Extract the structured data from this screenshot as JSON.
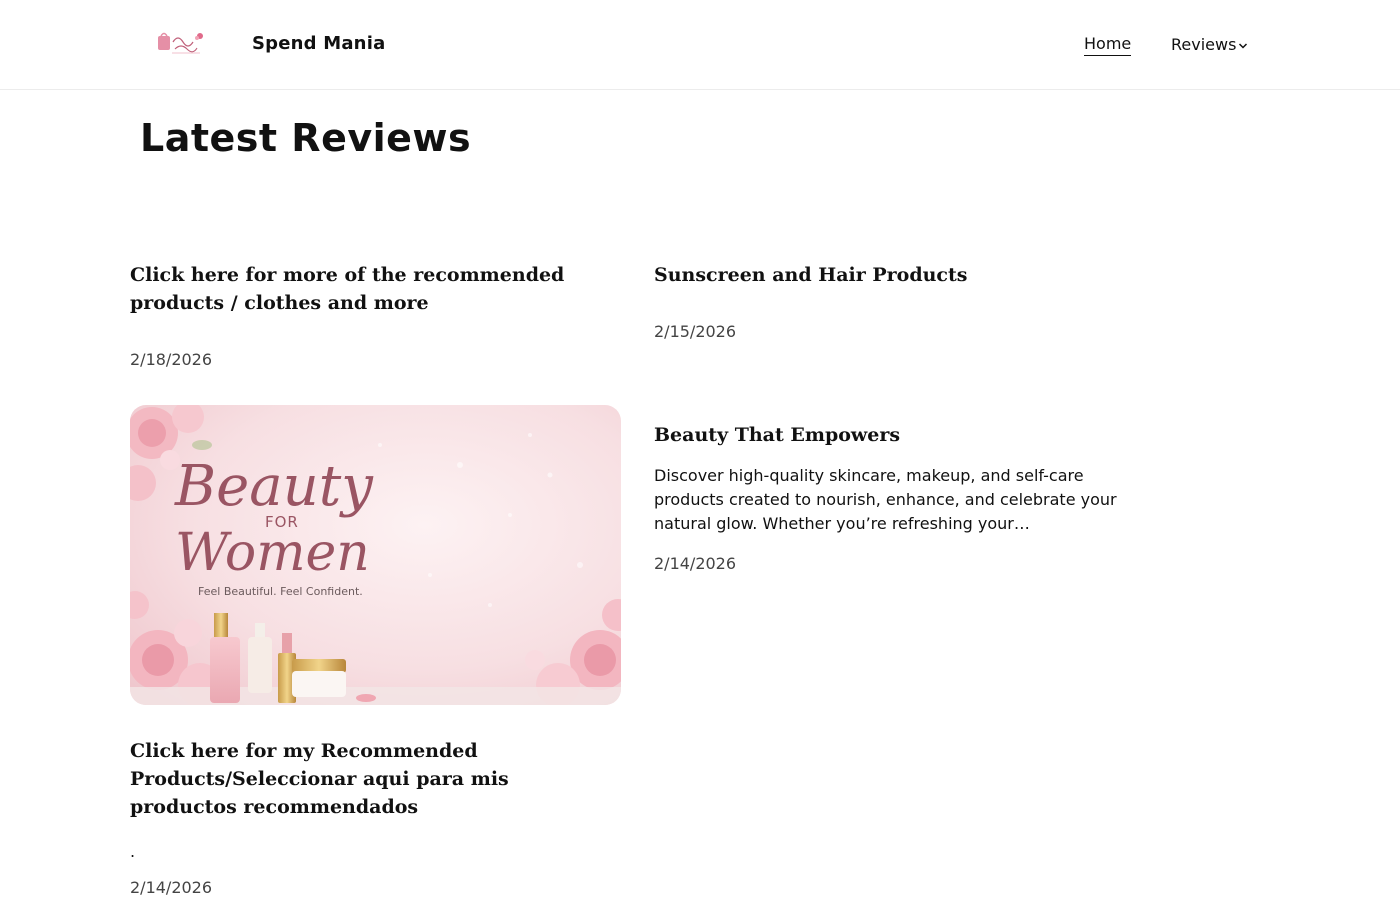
{
  "header": {
    "logo_alt": "Beauty & Fashion",
    "site_title": "Spend Mania",
    "nav": {
      "home_label": "Home",
      "reviews_label": "Reviews"
    }
  },
  "main": {
    "heading": "Latest Reviews",
    "posts": [
      {
        "title": "Click here for more of the recommended products / clothes and more",
        "date": "2/18/2026"
      },
      {
        "title": "Sunscreen and Hair Products",
        "date": "2/15/2026"
      },
      {
        "image": {
          "script_line1": "Beauty",
          "for_text": "FOR",
          "script_line2": "Women",
          "tagline": "Feel Beautiful. Feel Confident."
        },
        "title": "Click here for my Recommended Products/Seleccionar aqui para mis productos recommendados",
        "excerpt": ".",
        "date": "2/14/2026"
      },
      {
        "title": "Beauty That Empowers",
        "excerpt": "Discover high-quality skincare, makeup, and self-care products created to nourish, enhance, and celebrate your natural glow. Whether you’re refreshing your…",
        "date": "2/14/2026"
      }
    ]
  },
  "colors": {
    "text": "#111111",
    "date": "#444444",
    "accent_pink": "#f3c6cf",
    "script_mauve": "#9a5563"
  },
  "icons": {
    "nav_dropdown": "chevron-down-icon"
  }
}
